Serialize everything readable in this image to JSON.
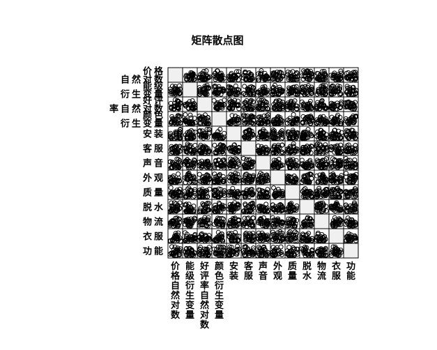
{
  "chart_data": {
    "type": "scatter",
    "title": "矩阵散点图",
    "variables": [
      {
        "name": "价格自然对数",
        "row_label": [
          "价格",
          "自然对数"
        ],
        "col_label": [
          "价",
          "格",
          "自",
          "然",
          "对",
          "数"
        ]
      },
      {
        "name": "能级衍生变量",
        "row_label": [
          "能级",
          "衍生变量"
        ],
        "col_label": [
          "能",
          "级",
          "衍",
          "生",
          "变",
          "量"
        ]
      },
      {
        "name": "好评率自然对数",
        "row_label": [
          "好评",
          "率自然对数"
        ],
        "col_label": [
          "好",
          "评",
          "率",
          "自",
          "然",
          "对",
          "数"
        ]
      },
      {
        "name": "颜色衍生变量",
        "row_label": [
          "颜色",
          "衍生变量"
        ],
        "col_label": [
          "颜",
          "色",
          "衍",
          "生",
          "变",
          "量"
        ]
      },
      {
        "name": "安装",
        "row_label": [
          "安装"
        ],
        "col_label": [
          "安",
          "装"
        ]
      },
      {
        "name": "客服",
        "row_label": [
          "客服"
        ],
        "col_label": [
          "客",
          "服"
        ]
      },
      {
        "name": "声音",
        "row_label": [
          "声音"
        ],
        "col_label": [
          "声",
          "音"
        ]
      },
      {
        "name": "外观",
        "row_label": [
          "外观"
        ],
        "col_label": [
          "外",
          "观"
        ]
      },
      {
        "name": "质量",
        "row_label": [
          "质量"
        ],
        "col_label": [
          "质",
          "量"
        ]
      },
      {
        "name": "脱水",
        "row_label": [
          "脱水"
        ],
        "col_label": [
          "脱",
          "水"
        ]
      },
      {
        "name": "物流",
        "row_label": [
          "物流"
        ],
        "col_label": [
          "物",
          "流"
        ]
      },
      {
        "name": "衣服",
        "row_label": [
          "衣服"
        ],
        "col_label": [
          "衣",
          "服"
        ]
      },
      {
        "name": "功能",
        "row_label": [
          "功能"
        ],
        "col_label": [
          "功",
          "能"
        ]
      }
    ],
    "marker": "open-circle",
    "marker_color": "#000000",
    "diagonal_fill": "#f0f0f0",
    "grid": false,
    "axis_ticks": false
  }
}
